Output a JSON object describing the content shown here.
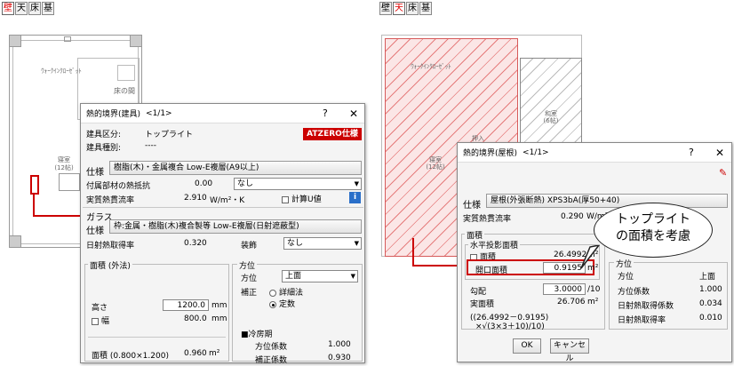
{
  "left": {
    "modes": [
      "壁",
      "天",
      "床",
      "基"
    ],
    "active_mode": "壁",
    "plan_labels": {
      "closet": "ｳｫｰｸｲﾝｸﾛｰｾﾞｯﾄ",
      "tokonoma": "床の間",
      "bedroom": "寝室",
      "bedroom_size": "(12帖)"
    },
    "dialog": {
      "title": "熱的境界(建具)",
      "page": "<1/1>",
      "help": "?",
      "close": "✕",
      "badge": "ATZERO仕様",
      "kind_label": "建具区分:",
      "kind_value": "トップライト",
      "type_label": "建具種別:",
      "type_value": "----",
      "spec_label": "仕様",
      "spec_value": "樹脂(木)・金属複合 Low-E複層(A9以上)",
      "attach_label": "付属部材の熱抵抗",
      "attach_value": "0.00",
      "attach_select": "なし",
      "u_label": "実質熱貫流率",
      "u_value": "2.910",
      "u_unit": "W/m²・K",
      "calc_u": "計算U値",
      "glass_group": "ガラス",
      "glass_spec_label": "仕様",
      "glass_spec_value": "枠:金属・樹脂(木)複合製等 Low-E複層(日射遮蔽型)",
      "shgc_label": "日射熱取得率",
      "shgc_value": "0.320",
      "deco_label": "装飾",
      "deco_select": "なし",
      "area_group": "面積 (外法)",
      "height_label": "高さ",
      "height_value": "1200.0",
      "height_unit": "mm",
      "width_label": "幅",
      "width_value": "800.0",
      "width_unit": "mm",
      "area_label": "面積 (0.800×1.200)",
      "area_value": "0.960",
      "area_unit": "m²",
      "dir_group": "方位",
      "dir_label": "方位",
      "dir_select": "上面",
      "corr_label": "補正",
      "corr_opt1": "詳細法",
      "corr_opt2": "定数",
      "cooling_label": "■冷房期",
      "dir_coef_label": "方位係数",
      "dir_coef_value": "1.000",
      "corr_coef_label": "補正係数",
      "corr_coef_value": "0.930"
    }
  },
  "right": {
    "modes": [
      "壁",
      "天",
      "床",
      "基"
    ],
    "active_mode": "天",
    "plan_labels": {
      "closet": "ｳｫｰｸｲﾝｸﾛｰｾﾞｯﾄ",
      "japanese": "和室",
      "japanese_size": "(6帖)",
      "bedroom": "寝室",
      "bedroom_size": "(12帖)",
      "oshiire": "押入"
    },
    "dialog": {
      "title": "熱的境界(屋根)",
      "page": "<1/1>",
      "help": "?",
      "close": "✕",
      "spec_label": "仕様",
      "spec_value": "屋根(外張断熱) XPS3bA(厚50+40)",
      "u_label": "実質熱貫流率",
      "u_value": "0.290",
      "u_unit": "W/m²",
      "area_group": "面積",
      "hproj_group": "水平投影面積",
      "hproj_label": "面積",
      "hproj_value": "26.4992",
      "hproj_unit": "m²",
      "opening_label": "開口面積",
      "opening_value": "0.9195",
      "opening_unit": "m²",
      "slope_label": "勾配",
      "slope_value": "3.0000",
      "slope_unit": "/10",
      "actual_label": "実面積",
      "actual_value": "26.706",
      "actual_unit": "m²",
      "formula1": "((26.4992－0.9195)",
      "formula2": "×√(3×3＋10)/10)",
      "dir_group": "方位",
      "dir_label": "方位",
      "dir_value": "上面",
      "dir_coef_label": "方位係数",
      "dir_coef_value": "1.000",
      "ach_label": "日射熱取得係数",
      "ach_value": "0.034",
      "shgc_label": "日射熱取得率",
      "shgc_value": "0.010",
      "ok": "OK",
      "cancel": "キャンセル"
    },
    "callout": "トップライト\nの面積を考慮"
  }
}
